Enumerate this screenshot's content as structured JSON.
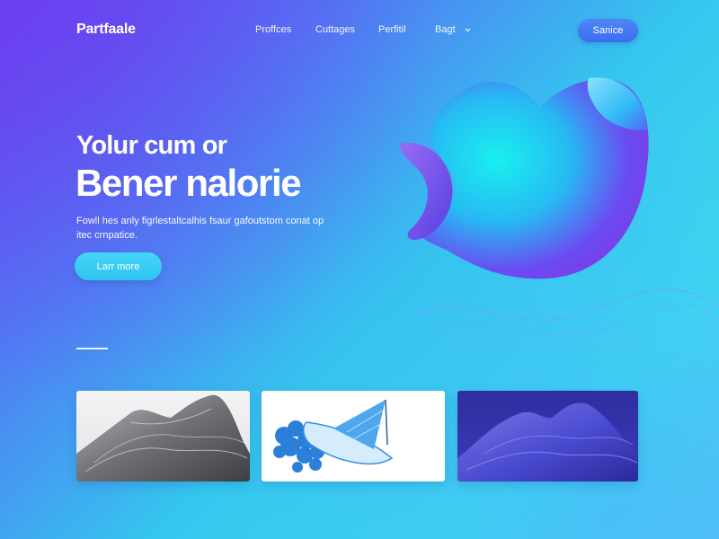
{
  "header": {
    "logo": "Partfaale",
    "nav": [
      {
        "label": "Proffces"
      },
      {
        "label": "Cuttages"
      },
      {
        "label": "Perfitil"
      },
      {
        "label": "Bagt",
        "icon": "chevron-down-icon"
      }
    ],
    "cta_label": "Sanice"
  },
  "hero": {
    "line1": "Yolur cum or",
    "line2": "Bener nalorie",
    "description": "Fowll hes anly figrlestaltcalhis fsaur gafoutstom conat op itec crnpatice.",
    "button_label": "Larr more"
  },
  "gallery": {
    "cards": [
      {
        "image": "gray-wave-mountain-image"
      },
      {
        "image": "blue-paper-boat-coral-image"
      },
      {
        "image": "purple-wave-mountain-image"
      }
    ]
  },
  "colors": {
    "gradient_start": "#6a3df0",
    "gradient_mid": "#35c6ee",
    "accent_button": "#3a6ef0",
    "learn_button": "#2fc3ef"
  }
}
